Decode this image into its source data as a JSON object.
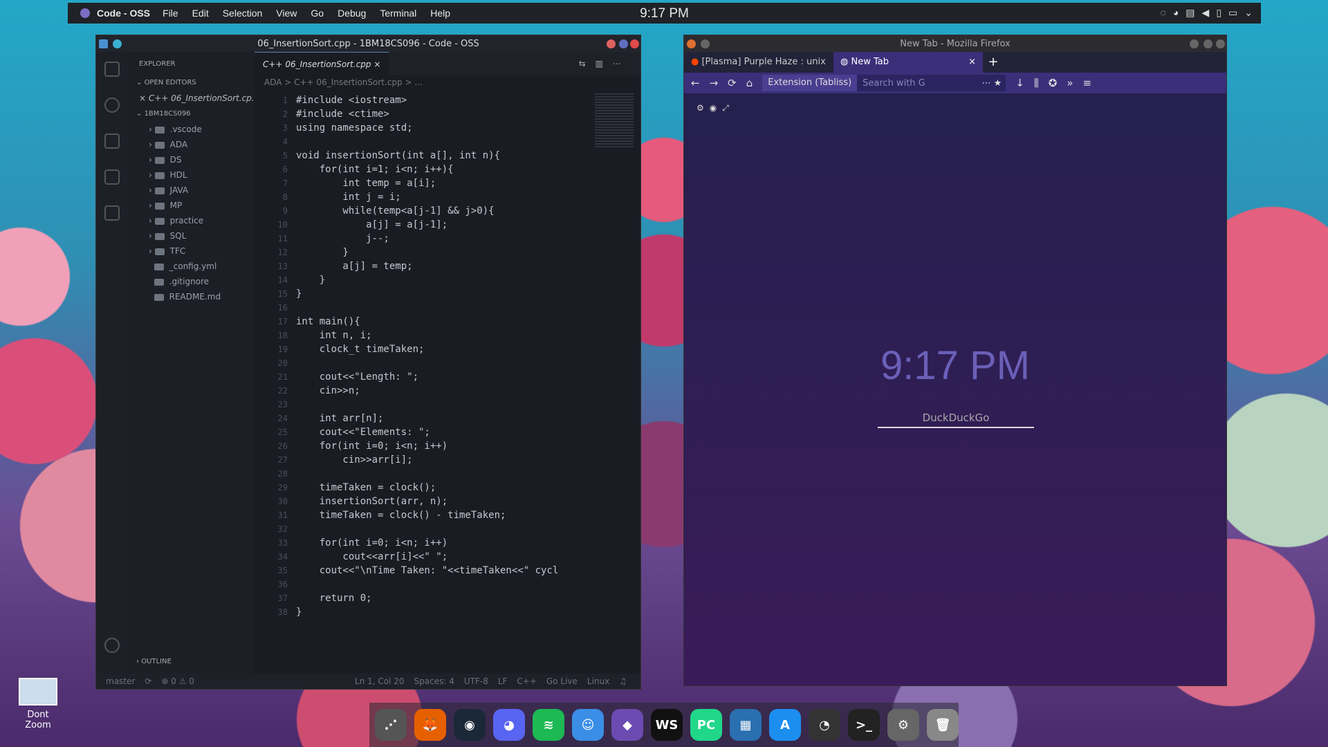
{
  "topbar": {
    "app": "Code - OSS",
    "menus": [
      "File",
      "Edit",
      "Selection",
      "View",
      "Go",
      "Debug",
      "Terminal",
      "Help"
    ],
    "clock": "9:17 PM"
  },
  "vscode": {
    "title": "06_InsertionSort.cpp - 1BM18CS096 - Code - OSS",
    "explorer": "EXPLORER",
    "open_editors": "OPEN EDITORS",
    "open_file": "06_InsertionSort.cp...",
    "folder": "1BM18CS096",
    "tree": [
      ".vscode",
      "ADA",
      "DS",
      "HDL",
      "JAVA",
      "MP",
      "practice",
      "SQL",
      "TFC",
      "_config.yml",
      ".gitignore",
      "README.md"
    ],
    "tab": "06_InsertionSort.cpp",
    "breadcrumb": "ADA > C++ 06_InsertionSort.cpp > ...",
    "outline": "OUTLINE",
    "code": [
      "#include <iostream>",
      "#include <ctime>",
      "using namespace std;",
      "",
      "void insertionSort(int a[], int n){",
      "    for(int i=1; i<n; i++){",
      "        int temp = a[i];",
      "        int j = i;",
      "        while(temp<a[j-1] && j>0){",
      "            a[j] = a[j-1];",
      "            j--;",
      "        }",
      "        a[j] = temp;",
      "    }",
      "}",
      "",
      "int main(){",
      "    int n, i;",
      "    clock_t timeTaken;",
      "",
      "    cout<<\"Length: \";",
      "    cin>>n;",
      "",
      "    int arr[n];",
      "    cout<<\"Elements: \";",
      "    for(int i=0; i<n; i++)",
      "        cin>>arr[i];",
      "",
      "    timeTaken = clock();",
      "    insertionSort(arr, n);",
      "    timeTaken = clock() - timeTaken;",
      "",
      "    for(int i=0; i<n; i++)",
      "        cout<<arr[i]<<\" \";",
      "    cout<<\"\\nTime Taken: \"<<timeTaken<<\" cycl",
      "",
      "    return 0;",
      "}"
    ],
    "status": {
      "branch": "master",
      "problems": "⊗ 0 ⚠ 0",
      "pos": "Ln 1, Col 20",
      "spaces": "Spaces: 4",
      "enc": "UTF-8",
      "eol": "LF",
      "lang": "C++",
      "live": "Go Live",
      "os": "Linux"
    }
  },
  "firefox": {
    "title": "New Tab - Mozilla Firefox",
    "tab1": "[Plasma] Purple Haze : unix",
    "tab2": "New Tab",
    "ext": "Extension (Tabliss)",
    "search_ph": "Search with G",
    "clock": "9:17 PM",
    "ddg": "DuckDuckGo"
  },
  "desktop": {
    "icon_label": "Dont Zoom"
  },
  "dock": [
    {
      "name": "launcher",
      "glyph": "⋰",
      "color": "#555"
    },
    {
      "name": "firefox",
      "glyph": "🦊",
      "color": "#e66000"
    },
    {
      "name": "steam",
      "glyph": "◉",
      "color": "#1b2838"
    },
    {
      "name": "discord",
      "glyph": "◕",
      "color": "#5865f2"
    },
    {
      "name": "spotify",
      "glyph": "≋",
      "color": "#1db954"
    },
    {
      "name": "finder",
      "glyph": "☺",
      "color": "#3a8ee6"
    },
    {
      "name": "vscodium",
      "glyph": "◆",
      "color": "#6b4bb0"
    },
    {
      "name": "webstorm",
      "glyph": "WS",
      "color": "#111"
    },
    {
      "name": "pycharm",
      "glyph": "PC",
      "color": "#21d789"
    },
    {
      "name": "windows",
      "glyph": "▦",
      "color": "#2a6fb0"
    },
    {
      "name": "appstore",
      "glyph": "A",
      "color": "#1c8ef0"
    },
    {
      "name": "speedometer",
      "glyph": "◔",
      "color": "#333"
    },
    {
      "name": "terminal",
      "glyph": ">_",
      "color": "#222"
    },
    {
      "name": "settings",
      "glyph": "⚙",
      "color": "#666"
    },
    {
      "name": "trash",
      "glyph": "🗑",
      "color": "#888"
    }
  ]
}
